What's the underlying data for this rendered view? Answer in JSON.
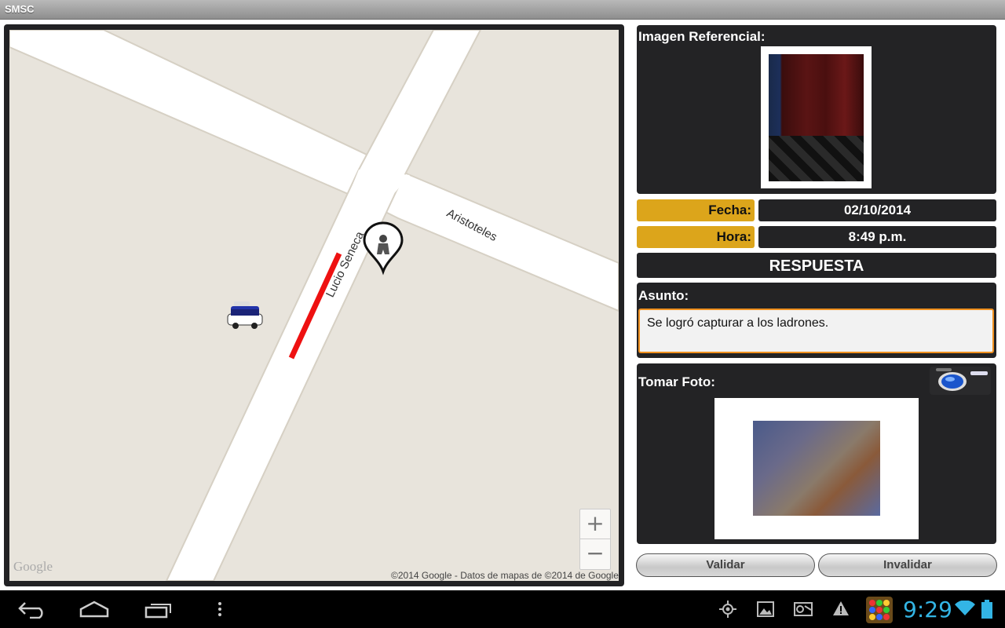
{
  "window": {
    "title": "SMSC"
  },
  "map": {
    "streets": [
      "Aristoteles",
      "Lucio Seneca"
    ],
    "zoom_in_label": "+",
    "zoom_out_label": "−",
    "logo_text": "Google",
    "attribution": "©2014 Google - Datos de mapas de ©2014 de Google"
  },
  "reference": {
    "label": "Imagen Referencial:"
  },
  "details": {
    "fecha_label": "Fecha:",
    "fecha_value": "02/10/2014",
    "hora_label": "Hora:",
    "hora_value": "8:49 p.m."
  },
  "response": {
    "heading": "RESPUESTA",
    "asunto_label": "Asunto:",
    "asunto_value": "Se logró capturar a los ladrones.",
    "foto_label": "Tomar Foto:"
  },
  "actions": {
    "validate_label": "Validar",
    "invalidate_label": "Invalidar"
  },
  "statusbar": {
    "clock": "9:29"
  },
  "colors": {
    "accent_gold": "#dca51b",
    "input_border": "#f0901e",
    "clock_blue": "#33b5e5",
    "route_red": "#ee1111"
  }
}
